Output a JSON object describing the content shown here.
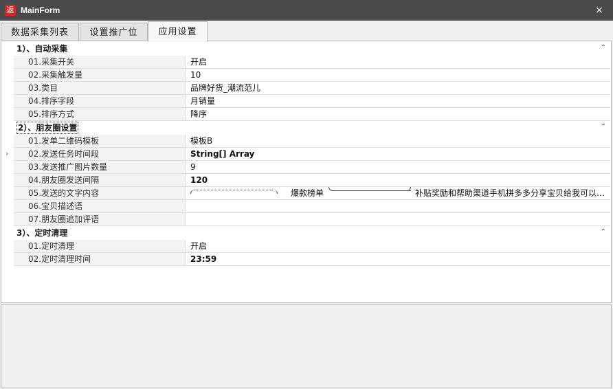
{
  "window": {
    "title": "MainForm",
    "app_icon_glyph": "返",
    "close_glyph": "×"
  },
  "tabs": [
    {
      "label": "数据采集列表"
    },
    {
      "label": "设置推广位"
    },
    {
      "label": "应用设置",
      "active": true
    }
  ],
  "grid": {
    "collapse_glyph": "⌃",
    "pointer_glyph": "›",
    "categories": [
      {
        "title": "1）、自动采集",
        "properties": [
          {
            "name": "01.采集开关",
            "value": "开启"
          },
          {
            "name": "02.采集触发量",
            "value": "10"
          },
          {
            "name": "03.类目",
            "value": "品牌好货_潮流范儿"
          },
          {
            "name": "04.排序字段",
            "value": "月销量"
          },
          {
            "name": "05.排序方式",
            "value": "降序"
          }
        ]
      },
      {
        "title": "2）、朋友圈设置",
        "properties": [
          {
            "name": "01.发单二维码模板",
            "value": "模板B"
          },
          {
            "name": "02.发送任务时间段",
            "value": "String[] Array",
            "selected": true
          },
          {
            "name": "03.发送推广图片数量",
            "value": "9"
          },
          {
            "name": "04.朋友圈发送间隔",
            "value": "120"
          },
          {
            "name": "05.发送的文字内容",
            "value_parts": [
              "爆款榜单",
              "补贴奖励和帮助渠道手机拼多多分享宝贝给我可以…"
            ]
          },
          {
            "name": "06.宝贝描述语",
            "value": ""
          },
          {
            "name": "07.朋友圈追加评语",
            "value": ""
          }
        ]
      },
      {
        "title": "3）、定时清理",
        "properties": [
          {
            "name": "01.定时清理",
            "value": "开启"
          },
          {
            "name": "02.定时清理时间",
            "value": "23:59"
          }
        ]
      }
    ]
  }
}
